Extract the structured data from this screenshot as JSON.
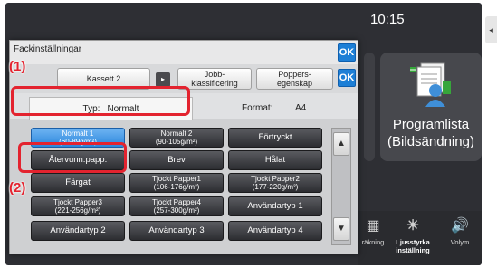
{
  "status": {
    "clock": "10:15",
    "side_tab": "◂"
  },
  "home": {
    "program_list_label_line1": "Programlista",
    "program_list_label_line2": "(Bildsändning)",
    "bottom_items": [
      {
        "label": "räkning",
        "icon": "counter-icon"
      },
      {
        "label": "Ljusstyrka inställning",
        "icon": "brightness-icon"
      },
      {
        "label": "Volym",
        "icon": "volume-icon"
      }
    ]
  },
  "dialog": {
    "title": "Fackinställningar",
    "ok_label": "OK",
    "tabs": {
      "tray": "Kassett 2",
      "arrow": "▸",
      "job_classification": "Jobb-\nklassificering",
      "paper_property": "Poppers-\negenskap"
    },
    "type_label": "Typ:",
    "type_value": "Normalt",
    "format_label": "Format:",
    "format_value": "A4",
    "paper_buttons": [
      {
        "line1": "Normalt 1",
        "line2": "(60-89g/m²)",
        "selected": true
      },
      {
        "line1": "Normalt 2",
        "line2": "(90-105g/m²)",
        "selected": false
      },
      {
        "line1": "Förtryckt",
        "line2": "",
        "selected": false
      },
      {
        "line1": "Återvunn.papp.",
        "line2": "",
        "selected": false
      },
      {
        "line1": "Brev",
        "line2": "",
        "selected": false
      },
      {
        "line1": "Hålat",
        "line2": "",
        "selected": false
      },
      {
        "line1": "Färgat",
        "line2": "",
        "selected": false
      },
      {
        "line1": "Tjockt Papper1",
        "line2": "(106-176g/m²)",
        "selected": false
      },
      {
        "line1": "Tjockt Papper2",
        "line2": "(177-220g/m²)",
        "selected": false
      },
      {
        "line1": "Tjockt Papper3",
        "line2": "(221-256g/m²)",
        "selected": false
      },
      {
        "line1": "Tjockt Papper4",
        "line2": "(257-300g/m²)",
        "selected": false
      },
      {
        "line1": "Användartyp 1",
        "line2": "",
        "selected": false
      },
      {
        "line1": "Användartyp 2",
        "line2": "",
        "selected": false
      },
      {
        "line1": "Användartyp 3",
        "line2": "",
        "selected": false
      },
      {
        "line1": "Användartyp 4",
        "line2": "",
        "selected": false
      }
    ],
    "scroll_up": "▲",
    "scroll_down": "▼"
  },
  "callouts": {
    "one": "(1)",
    "two": "(2)"
  },
  "colors": {
    "accent": "#1d7fd6",
    "callout": "#e3232f",
    "selected": "#2a86dc"
  }
}
